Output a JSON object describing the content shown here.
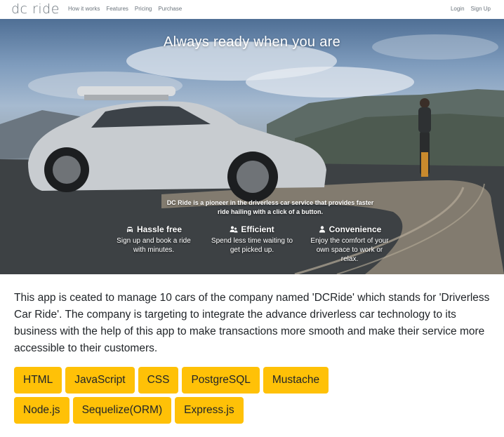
{
  "navbar": {
    "brand": "dc ride",
    "links": [
      "How it works",
      "Features",
      "Pricing",
      "Purchase"
    ],
    "right_links": [
      "Login",
      "Sign Up"
    ]
  },
  "hero": {
    "title": "Always ready when you are",
    "subtitle": "DC Ride is a pioneer in the driverless car service that provides faster ride hailing with a click of a button.",
    "features": [
      {
        "icon": "car-icon",
        "title": "Hassle free",
        "text": "Sign up and book a ride with minutes."
      },
      {
        "icon": "users-icon",
        "title": "Efficient",
        "text": "Spend less time waiting to get picked up."
      },
      {
        "icon": "user-icon",
        "title": "Convenience",
        "text": "Enjoy the comfort of your own space to work or relax."
      }
    ]
  },
  "description": "This app is ceated to manage 10 cars of the company named 'DCRide' which stands for 'Driverless Car Ride'. The company is targeting to integrate the advance driverless car technology to its business with the help of this app to make transactions more smooth and make their service more accessible to their customers.",
  "tags": [
    "HTML",
    "JavaScript",
    "CSS",
    "PostgreSQL",
    "Mustache",
    "Node.js",
    "Sequelize(ORM)",
    "Express.js"
  ],
  "colors": {
    "tag_bg": "#ffc107",
    "nav_text": "#6c757d",
    "body_text": "#212529"
  }
}
